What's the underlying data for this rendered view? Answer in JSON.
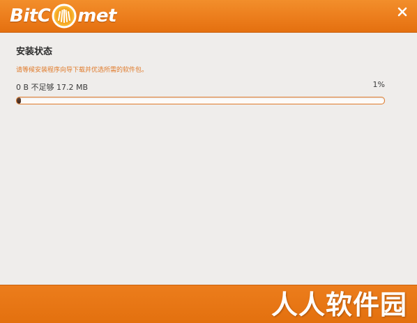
{
  "app": {
    "logo_prefix": "BitC",
    "logo_suffix": "met"
  },
  "colors": {
    "header_orange": "#ec7d1c",
    "accent_orange": "#e07a2a",
    "background": "#efedeb"
  },
  "icons": {
    "close": "close-icon",
    "logo": "comet-logo-icon"
  },
  "install": {
    "title": "安装状态",
    "subtitle": "请等候安装程序向导下载并优选所需的软件包。",
    "size_text": "0 B 不足够 17.2 MB",
    "percent_text": "1%",
    "progress_percent": 1
  },
  "footer": {
    "watermark": "人人软件园"
  }
}
